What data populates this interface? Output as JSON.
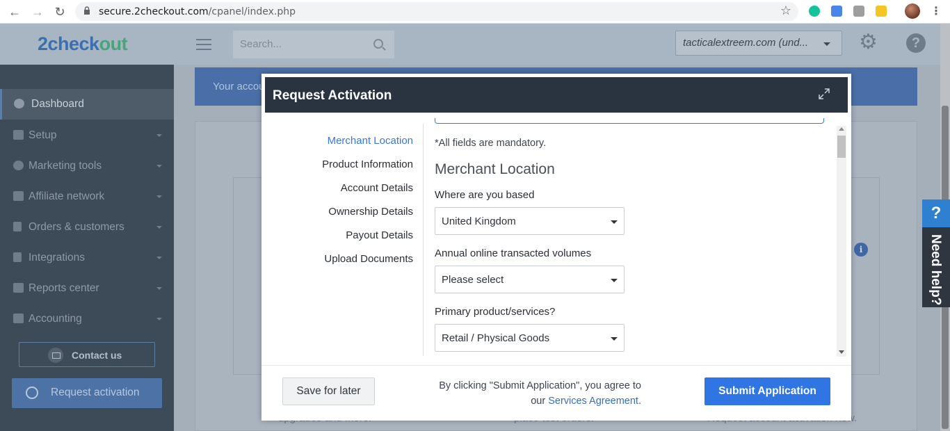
{
  "browser": {
    "url_host": "secure.2checkout.com",
    "url_path": "/cpanel/index.php"
  },
  "header": {
    "logo_main": "2check",
    "logo_accent": "out",
    "search_placeholder": "Search...",
    "account_selector": "tacticalextreem.com (und..."
  },
  "sidebar": {
    "items": [
      {
        "label": "Dashboard",
        "icon": "palette-icon"
      },
      {
        "label": "Setup",
        "icon": "sliders-icon"
      },
      {
        "label": "Marketing tools",
        "icon": "pie-chart-icon"
      },
      {
        "label": "Affiliate network",
        "icon": "handshake-icon"
      },
      {
        "label": "Orders & customers",
        "icon": "clipboard-icon"
      },
      {
        "label": "Integrations",
        "icon": "plug-icon"
      },
      {
        "label": "Reports center",
        "icon": "bar-chart-icon"
      },
      {
        "label": "Accounting",
        "icon": "ledger-icon"
      }
    ],
    "contact": "Contact us",
    "request_activation": "Request activation"
  },
  "main": {
    "banner_text": "Your accou",
    "bg_text_1": "upgrades and more.",
    "bg_text_2": "place test orders.",
    "bg_text_3": "Request account activation now."
  },
  "help_tab": {
    "q": "?",
    "label": "Need help?"
  },
  "modal": {
    "title": "Request Activation",
    "steps": [
      "Merchant Location",
      "Product Information",
      "Account Details",
      "Ownership Details",
      "Payout Details",
      "Upload Documents"
    ],
    "mandatory_note": "*All fields are mandatory.",
    "section_title": "Merchant Location",
    "fields": [
      {
        "label": "Where are you based",
        "value": "United Kingdom"
      },
      {
        "label": "Annual online transacted volumes",
        "value": "Please select"
      },
      {
        "label": "Primary product/services?",
        "value": "Retail / Physical Goods"
      }
    ],
    "save_label": "Save for later",
    "agree_text": "By clicking \"Submit Application\", you agree to our",
    "agree_link": "Services Agreement",
    "agree_end": ".",
    "submit_label": "Submit Application"
  },
  "colors": {
    "accent_blue": "#2f75e3",
    "modal_header": "#2a3440",
    "active_step": "#3b78d6"
  }
}
